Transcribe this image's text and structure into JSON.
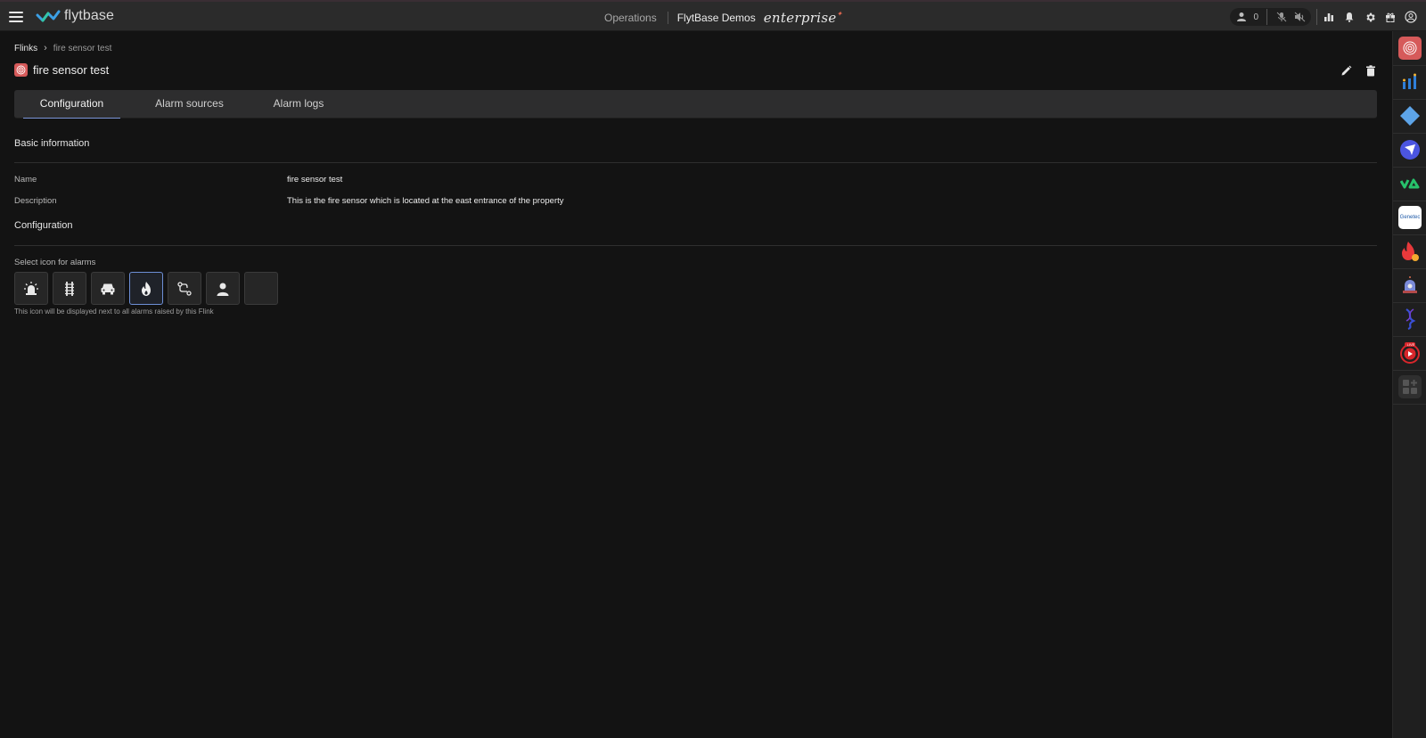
{
  "topbar": {
    "logo_text": "flytbase",
    "operations": "Operations",
    "org_name": "FlytBase Demos",
    "edition": "enterprise",
    "user_count": "0",
    "icons": [
      "menu-icon",
      "users-icon",
      "mic-off-icon",
      "speaker-off-icon",
      "analytics-icon",
      "bell-icon",
      "gear-icon",
      "gift-icon",
      "account-icon"
    ]
  },
  "breadcrumb": {
    "root": "Flinks",
    "current": "fire sensor test"
  },
  "page": {
    "title": "fire sensor test"
  },
  "tabs": [
    {
      "label": "Configuration",
      "active": true
    },
    {
      "label": "Alarm sources",
      "active": false
    },
    {
      "label": "Alarm logs",
      "active": false
    }
  ],
  "basic_info": {
    "heading": "Basic information",
    "name_label": "Name",
    "name_value": "fire sensor test",
    "description_label": "Description",
    "description_value": "This is the fire sensor which is located at the east entrance of the property"
  },
  "configuration": {
    "heading": "Configuration",
    "select_label": "Select icon for alarms",
    "icons": [
      "siren-icon",
      "fence-icon",
      "vehicle-icon",
      "fire-icon",
      "route-icon",
      "person-icon",
      "empty-slot"
    ],
    "selected_icon": "fire-icon",
    "hint": "This icon will be displayed next to all alarms raised by this Flink"
  },
  "rail": {
    "items": [
      "fire-sensor-app-icon",
      "integration-app-icon",
      "diamond-app-icon",
      "arrow-app-icon",
      "va-app-icon",
      "genetec-app-icon",
      "flame-app-icon",
      "alarm-app-icon",
      "dna-app-icon",
      "live-app-icon",
      "add-app-icon"
    ],
    "genetec_text": "Genetec",
    "live_text": "LIVE"
  }
}
